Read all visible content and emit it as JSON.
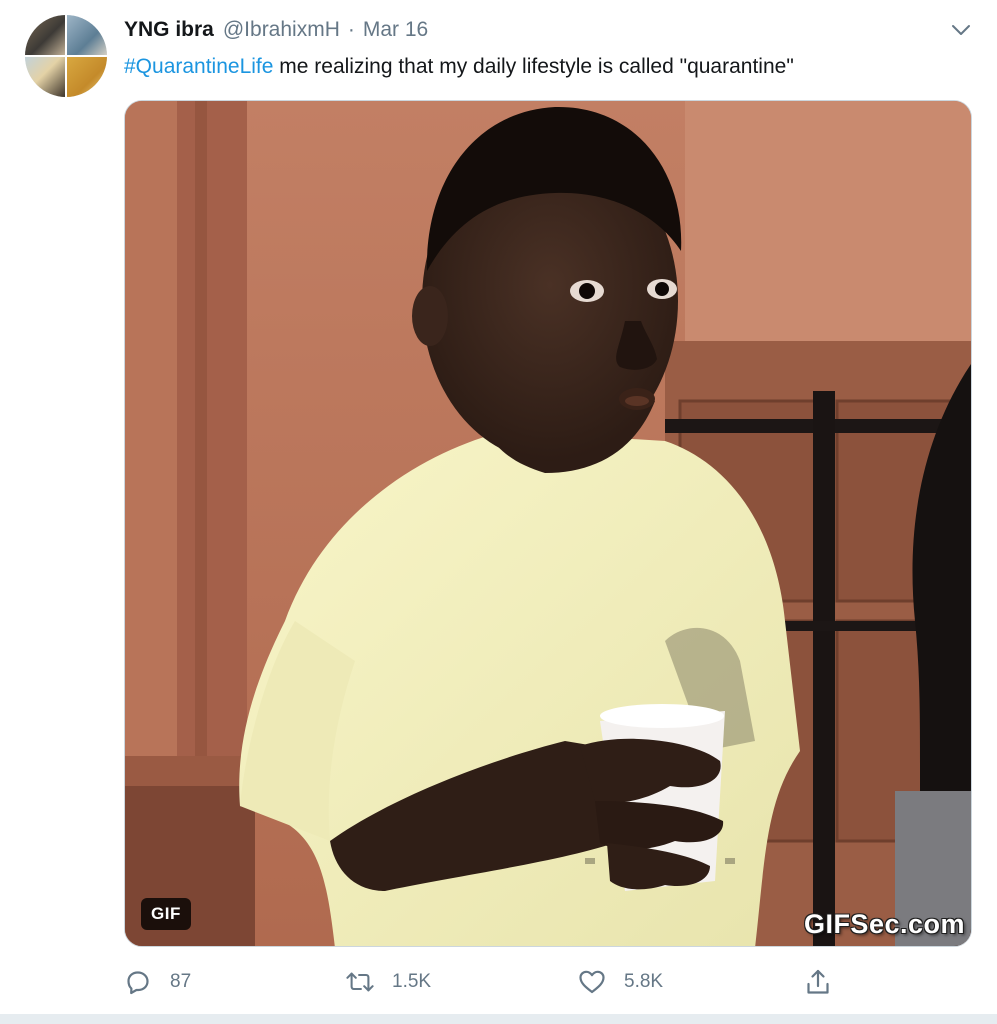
{
  "tweet": {
    "display_name": "YNG ibra",
    "handle": "@IbrahixmH",
    "separator": "·",
    "date": "Mar 16",
    "text": {
      "hashtag": "#QuarantineLife",
      "body": " me realizing that my daily lifestyle is called \"quarantine\""
    },
    "media": {
      "badge": "GIF",
      "watermark": "GIFSec.com"
    },
    "actions": {
      "reply_count": "87",
      "retweet_count": "1.5K",
      "like_count": "5.8K"
    }
  },
  "icons": {
    "caret": "chevron-down-icon",
    "reply": "reply-icon",
    "retweet": "retweet-icon",
    "like": "heart-icon",
    "share": "share-icon"
  },
  "colors": {
    "link": "#1b95e0",
    "secondary_text": "#657786",
    "primary_text": "#14171a",
    "border": "#ccd6dd",
    "page_strip": "#e6ecf0"
  }
}
